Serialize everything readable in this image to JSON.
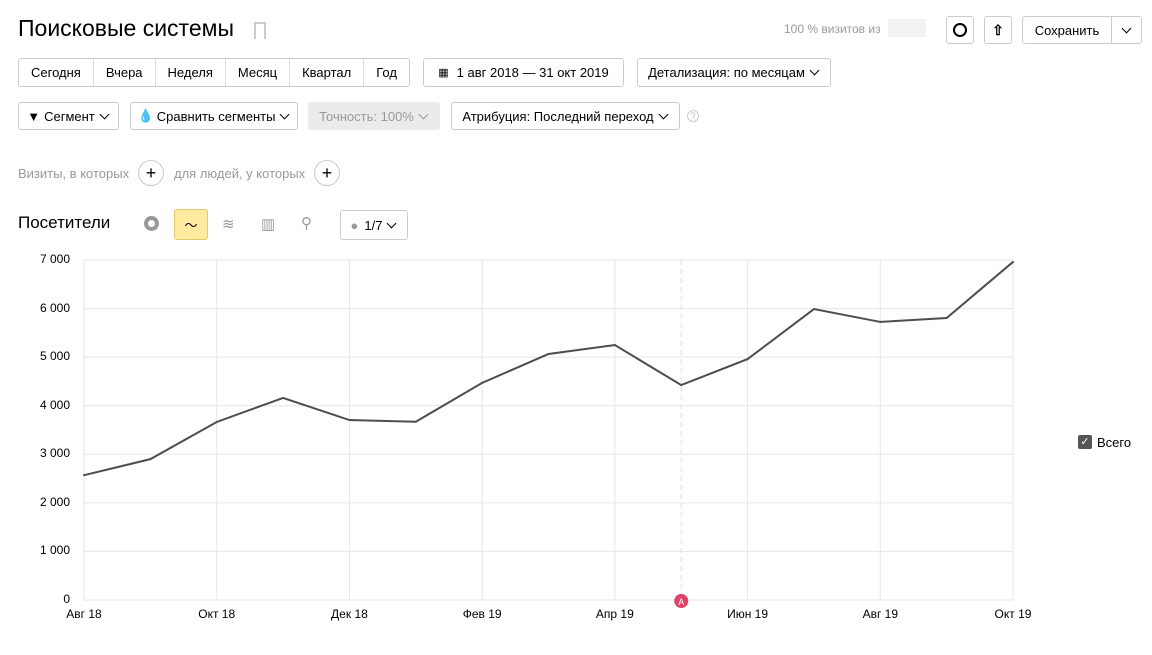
{
  "header": {
    "title": "Поисковые системы",
    "visits_pct": "100 % визитов из",
    "save": "Сохранить"
  },
  "periods": [
    "Сегодня",
    "Вчера",
    "Неделя",
    "Месяц",
    "Квартал",
    "Год"
  ],
  "date_range": "1 авг 2018 — 31 окт 2019",
  "detail": "Детализация: по месяцам",
  "filters": {
    "segment": "Сегмент",
    "compare": "Сравнить сегменты",
    "accuracy": "Точность: 100%",
    "attribution": "Атрибуция: Последний переход",
    "help": "?"
  },
  "conditions": {
    "visits": "Визиты, в которых",
    "people": "для людей, у которых"
  },
  "chart_header": {
    "metric": "Посетители",
    "annotations": "1/7"
  },
  "legend": {
    "label": "Всего",
    "checked": true
  },
  "annotation_marker": "A",
  "chart_data": {
    "type": "line",
    "categories": [
      "Авг 18",
      "Сен 18",
      "Окт 18",
      "Ноя 18",
      "Дек 18",
      "Янв 19",
      "Фев 19",
      "Мар 19",
      "Апр 19",
      "Май 19",
      "Июн 19",
      "Июл 19",
      "Авг 19",
      "Сен 19",
      "Окт 19"
    ],
    "x_tick_labels": [
      "Авг 18",
      "Окт 18",
      "Дек 18",
      "Фев 19",
      "Апр 19",
      "Июн 19",
      "Авг 19",
      "Окт 19"
    ],
    "series": [
      {
        "name": "Всего",
        "values": [
          2570,
          2900,
          3665,
          4160,
          3705,
          3670,
          4470,
          5065,
          5250,
          4425,
          4960,
          5990,
          5725,
          5805,
          6960
        ],
        "color": "#4d4d4d"
      }
    ],
    "y_ticks": [
      "0",
      "1 000",
      "2 000",
      "3 000",
      "4 000",
      "5 000",
      "6 000",
      "7 000"
    ],
    "ylim": [
      0,
      7000
    ],
    "grid": true,
    "legend": "right"
  }
}
